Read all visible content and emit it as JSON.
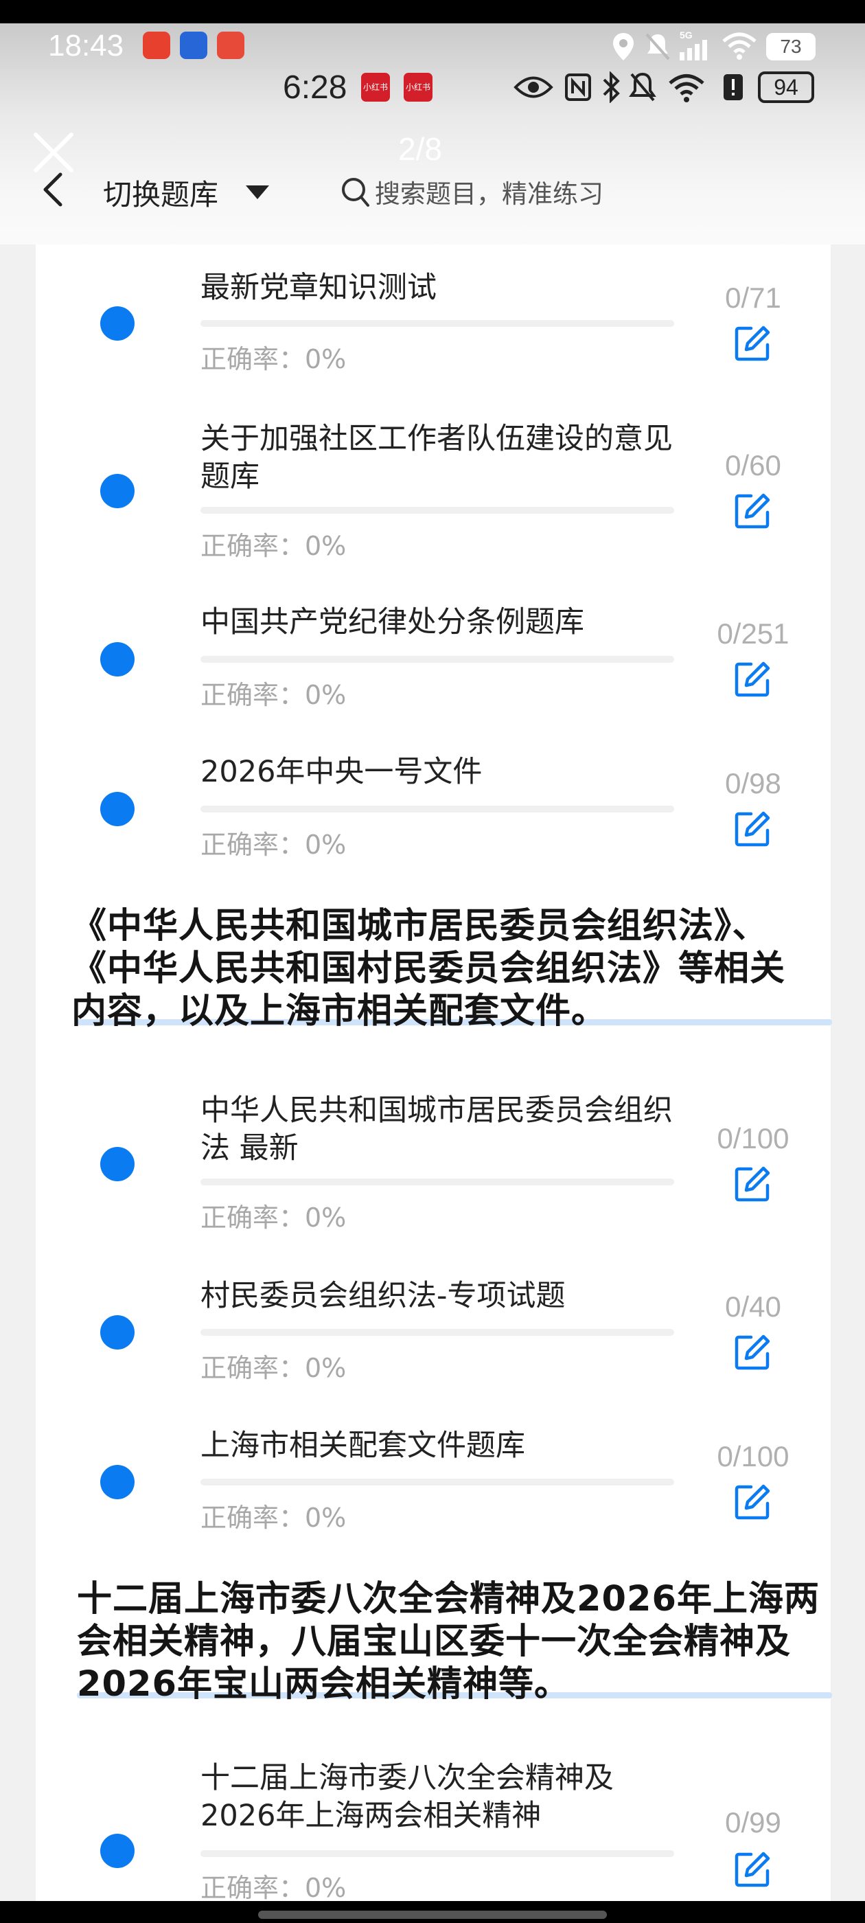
{
  "status_bar_outer": {
    "time": "18:43",
    "battery": "73"
  },
  "status_bar_inner": {
    "time": "6:28",
    "app_badge": "小红书",
    "battery": "94"
  },
  "header": {
    "page_indicator": "2/8",
    "switch_bank_label": "切换题库",
    "search_placeholder": "搜索题目，精准练习"
  },
  "colors": {
    "accent": "#0a7bf0",
    "section_underline": "#cfe3fb"
  },
  "sections": [
    {
      "items": [
        {
          "title": "最新党章知识测试",
          "accuracy": "正确率：0%",
          "count": "0/71",
          "progress": 0
        },
        {
          "title": "关于加强社区工作者队伍建设的意见题库",
          "accuracy": "正确率：0%",
          "count": "0/60",
          "progress": 0
        },
        {
          "title": "中国共产党纪律处分条例题库",
          "accuracy": "正确率：0%",
          "count": "0/251",
          "progress": 0
        },
        {
          "title": "2026年中央一号文件",
          "accuracy": "正确率：0%",
          "count": "0/98",
          "progress": 0
        }
      ]
    },
    {
      "heading": "《中华人民共和国城市居民委员会组织法》、《中华人民共和国村民委员会组织法》等相关内容，以及上海市相关配套文件。",
      "items": [
        {
          "title": "中华人民共和国城市居民委员会组织法 最新",
          "accuracy": "正确率：0%",
          "count": "0/100",
          "progress": 0
        },
        {
          "title": "村民委员会组织法-专项试题",
          "accuracy": "正确率：0%",
          "count": "0/40",
          "progress": 0
        },
        {
          "title": "上海市相关配套文件题库",
          "accuracy": "正确率：0%",
          "count": "0/100",
          "progress": 0
        }
      ]
    },
    {
      "heading": "十二届上海市委八次全会精神及2026年上海两会相关精神，八届宝山区委十一次全会精神及2026年宝山两会相关精神等。",
      "items": [
        {
          "title": "十二届上海市委八次全会精神及2026年上海两会相关精神",
          "accuracy": "正确率：0%",
          "count": "0/99",
          "progress": 0
        }
      ]
    }
  ]
}
